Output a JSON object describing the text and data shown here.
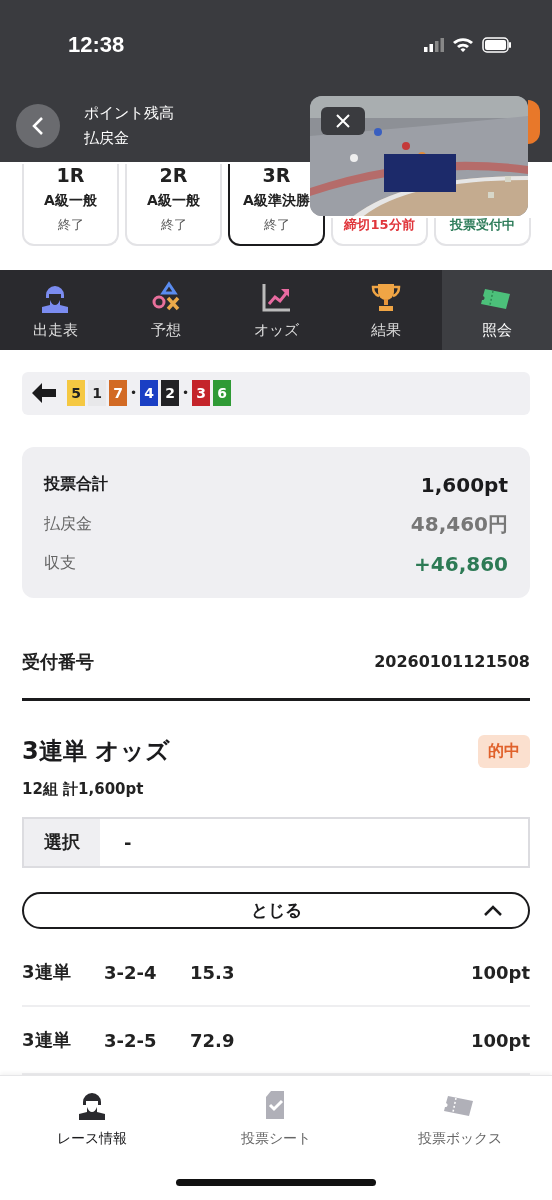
{
  "status_bar": {
    "time": "12:38"
  },
  "header": {
    "title": "ポイント残高",
    "subtitle": "払戻金"
  },
  "races": [
    {
      "number": "1R",
      "class": "A級一般",
      "status": "終了",
      "selected": false,
      "color": "#555555"
    },
    {
      "number": "2R",
      "class": "A級一般",
      "status": "終了",
      "selected": false,
      "color": "#555555"
    },
    {
      "number": "3R",
      "class": "A級準決勝",
      "status": "終了",
      "selected": true,
      "color": "#555555"
    },
    {
      "status": "締切15分前",
      "selected": false,
      "color": "#e0353b"
    },
    {
      "status": "投票受付中",
      "selected": false,
      "color": "#2f7d5b"
    }
  ],
  "nav_tabs": [
    {
      "label": "出走表",
      "kind": "rider",
      "selected": false
    },
    {
      "label": "予想",
      "kind": "symbols",
      "selected": false
    },
    {
      "label": "オッズ",
      "kind": "chart",
      "selected": false
    },
    {
      "label": "結果",
      "kind": "trophy",
      "selected": false
    },
    {
      "label": "照会",
      "kind": "ticket",
      "selected": true
    }
  ],
  "line_formation": {
    "separator": "•",
    "groups": [
      [
        {
          "number": "5",
          "color": "#f5c842"
        },
        {
          "number": "1",
          "color": "#e8e8ea"
        },
        {
          "number": "7",
          "color": "#d26a24"
        }
      ],
      [
        {
          "number": "4",
          "color": "#1a3fc4"
        },
        {
          "number": "2",
          "color": "#222225"
        }
      ],
      [
        {
          "number": "3",
          "color": "#c4242a"
        },
        {
          "number": "6",
          "color": "#2f9a35"
        }
      ]
    ]
  },
  "summary": [
    {
      "label": "投票合計",
      "value": "1,600pt",
      "kind": "total"
    },
    {
      "label": "払戻金",
      "value": "48,460円",
      "kind": "plain"
    },
    {
      "label": "収支",
      "value": "+46,860",
      "kind": "profit"
    }
  ],
  "receipt": {
    "label": "受付番号",
    "value": "20260101121508"
  },
  "bet": {
    "title": "3連単 オッズ",
    "badge": "的中",
    "subtitle": "12組 計1,600pt",
    "select": {
      "label": "選択",
      "value": "-"
    },
    "toggle": {
      "label": "とじる",
      "expanded": true
    },
    "rows": [
      {
        "type": "3連単",
        "combo": "3-2-4",
        "odds": "15.3",
        "amount": "100pt"
      },
      {
        "type": "3連単",
        "combo": "3-2-5",
        "odds": "72.9",
        "amount": "100pt"
      }
    ]
  },
  "bottom_tabs": [
    {
      "label": "レース情報",
      "kind": "rider",
      "selected": true
    },
    {
      "label": "投票シート",
      "kind": "sheet",
      "selected": false
    },
    {
      "label": "投票ボックス",
      "kind": "ticket",
      "selected": false
    }
  ]
}
